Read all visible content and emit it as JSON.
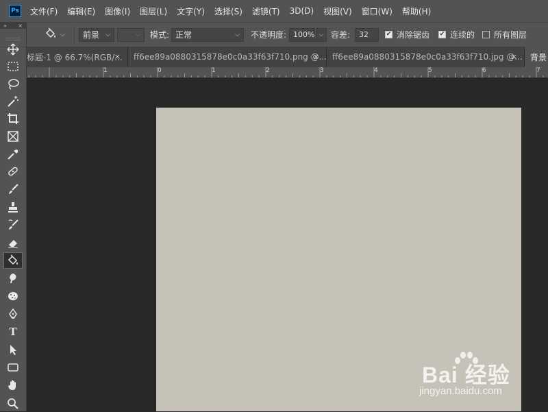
{
  "app": {
    "logo_text": "Ps",
    "accent_color": "#31a8ff",
    "canvas_color": "#c6c2b7",
    "workspace_color": "#282828"
  },
  "menu": [
    "文件(F)",
    "编辑(E)",
    "图像(I)",
    "图层(L)",
    "文字(Y)",
    "选择(S)",
    "滤镜(T)",
    "3D(D)",
    "视图(V)",
    "窗口(W)",
    "帮助(H)"
  ],
  "options": {
    "tool_icon": "paint-bucket-icon",
    "fill_source": "前景",
    "mode_label": "模式:",
    "mode_value": "正常",
    "opacity_label": "不透明度:",
    "opacity_value": "100%",
    "tolerance_label": "容差:",
    "tolerance_value": "32",
    "anti_alias_label": "消除锯齿",
    "anti_alias_checked": true,
    "contiguous_label": "连续的",
    "contiguous_checked": true,
    "all_layers_label": "所有图层",
    "all_layers_checked": false
  },
  "toolbar": {
    "collapse_glyph": "»",
    "close_glyph": "×",
    "tools": [
      {
        "name": "move-tool-icon"
      },
      {
        "name": "marquee-tool-icon"
      },
      {
        "name": "lasso-tool-icon"
      },
      {
        "name": "magic-wand-tool-icon"
      },
      {
        "name": "crop-tool-icon"
      },
      {
        "name": "frame-tool-icon"
      },
      {
        "name": "eyedropper-tool-icon"
      },
      {
        "name": "healing-tool-icon"
      },
      {
        "name": "brush-tool-icon"
      },
      {
        "name": "stamp-tool-icon"
      },
      {
        "name": "history-brush-tool-icon"
      },
      {
        "name": "eraser-tool-icon"
      },
      {
        "name": "paint-bucket-tool-icon",
        "active": true
      },
      {
        "name": "blur-tool-icon"
      },
      {
        "name": "sponge-tool-icon"
      },
      {
        "name": "pen-tool-icon"
      },
      {
        "name": "type-tool-icon",
        "label": "T"
      },
      {
        "name": "path-selection-tool-icon"
      },
      {
        "name": "rectangle-tool-icon"
      },
      {
        "name": "hand-tool-icon"
      },
      {
        "name": "zoom-tool-icon"
      }
    ]
  },
  "tabs": [
    {
      "label": "标题-1 @ 66.7%(RGB/...",
      "close": "×"
    },
    {
      "label": "ff6ee89a0880315878e0c0a33f63f710.png @...",
      "close": "×"
    },
    {
      "label": "ff6ee89a0880315878e0c0a33f63f710.jpg @...",
      "close": "×"
    },
    {
      "label": "背景",
      "close": "",
      "active": true
    }
  ],
  "ruler": {
    "labels": [
      "1",
      "0",
      "1",
      "2",
      "3",
      "4",
      "5",
      "6",
      "7"
    ]
  },
  "watermark": {
    "brand": "Bai 经验",
    "url": "jingyan.baidu.com"
  }
}
